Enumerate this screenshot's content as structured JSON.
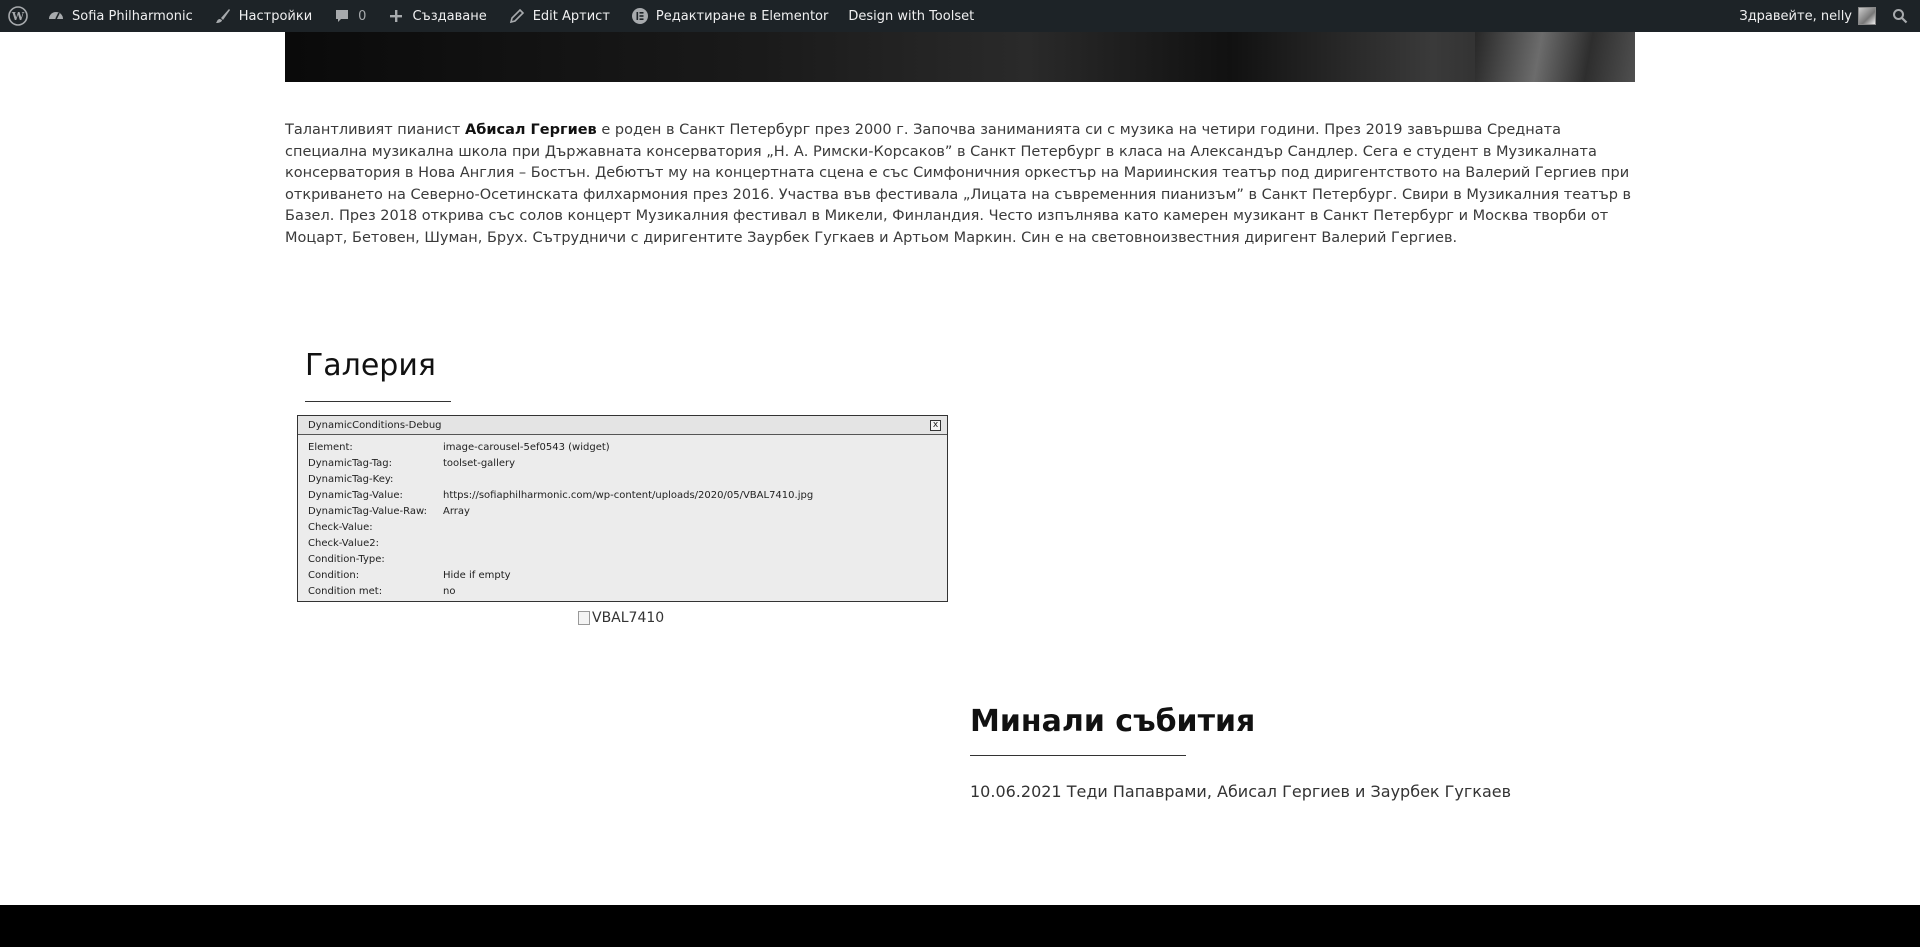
{
  "admin_bar": {
    "site_name": "Sofia Philharmonic",
    "settings_label": "Настройки",
    "comments_count": "0",
    "new_label": "Създаване",
    "edit_label": "Edit Артист",
    "elementor_label": "Редактиране в Elementor",
    "toolset_label": "Design with Toolset",
    "greeting": "Здравейте, nelly"
  },
  "bio": {
    "intro": "Талантливият пианист ",
    "name": "Абисал Гергиев",
    "text": " е роден в Санкт Петербург през 2000 г. Започва заниманията си с музика на четири години. През  2019 завършва Средната специална музикална школа при Държавната консерватория „Н. А. Римски-Корсаков” в Санкт Петербург в класа на Александър Сандлер. Сега е студент в Музикалната консерватория в Нова Англия – Бостън.  Дебютът му на концертната сцена е със Симфоничния оркестър на Мариинския театър под диригентството на Валерий Гергиев при откриването на Северно-Осетинската филхармония през 2016. Участва във фестивала „Лицата на съвременния пианизъм” в Санкт Петербург. Свири в Музикалния театър в Базел. През 2018 открива със солов концерт Музикалния фестивал в Микели, Финландия. Често изпълнява като камерен музикант в Санкт Петербург и Москва творби от Моцарт, Бетовен, Шуман, Брух. Сътрудничи с диригентите Заурбек Гугкаев и Артьом Маркин. Син е на световноизвестния диригент Валерий Гергиев."
  },
  "gallery": {
    "title": "Галерия",
    "image_alt": "VBAL7410"
  },
  "debug": {
    "title": "DynamicConditions-Debug",
    "close": "x",
    "rows": [
      {
        "key": "Element:",
        "value": "image-carousel-5ef0543 (widget)"
      },
      {
        "key": "DynamicTag-Tag:",
        "value": "toolset-gallery"
      },
      {
        "key": "DynamicTag-Key:",
        "value": ""
      },
      {
        "key": "DynamicTag-Value:",
        "value": "https://sofiaphilharmonic.com/wp-content/uploads/2020/05/VBAL7410.jpg"
      },
      {
        "key": "DynamicTag-Value-Raw:",
        "value": "Array"
      },
      {
        "key": "Check-Value:",
        "value": ""
      },
      {
        "key": "Check-Value2:",
        "value": ""
      },
      {
        "key": "Condition-Type:",
        "value": ""
      },
      {
        "key": "Condition:",
        "value": "Hide if empty"
      },
      {
        "key": "Condition met:",
        "value": "no"
      }
    ]
  },
  "past_events": {
    "title": "Минали събития",
    "items": [
      {
        "label": "10.06.2021 Теди Папаврами, Абисал Гергиев и Заурбек Гугкаев"
      }
    ]
  },
  "colors": {
    "admin_bar_bg": "#1d2327",
    "footer_bg": "#000000",
    "debug_bg": "#ececec"
  },
  "icons": [
    "wordpress-logo-icon",
    "dashboard-icon",
    "brush-icon",
    "comment-icon",
    "plus-icon",
    "pencil-icon",
    "elementor-icon",
    "search-icon"
  ]
}
